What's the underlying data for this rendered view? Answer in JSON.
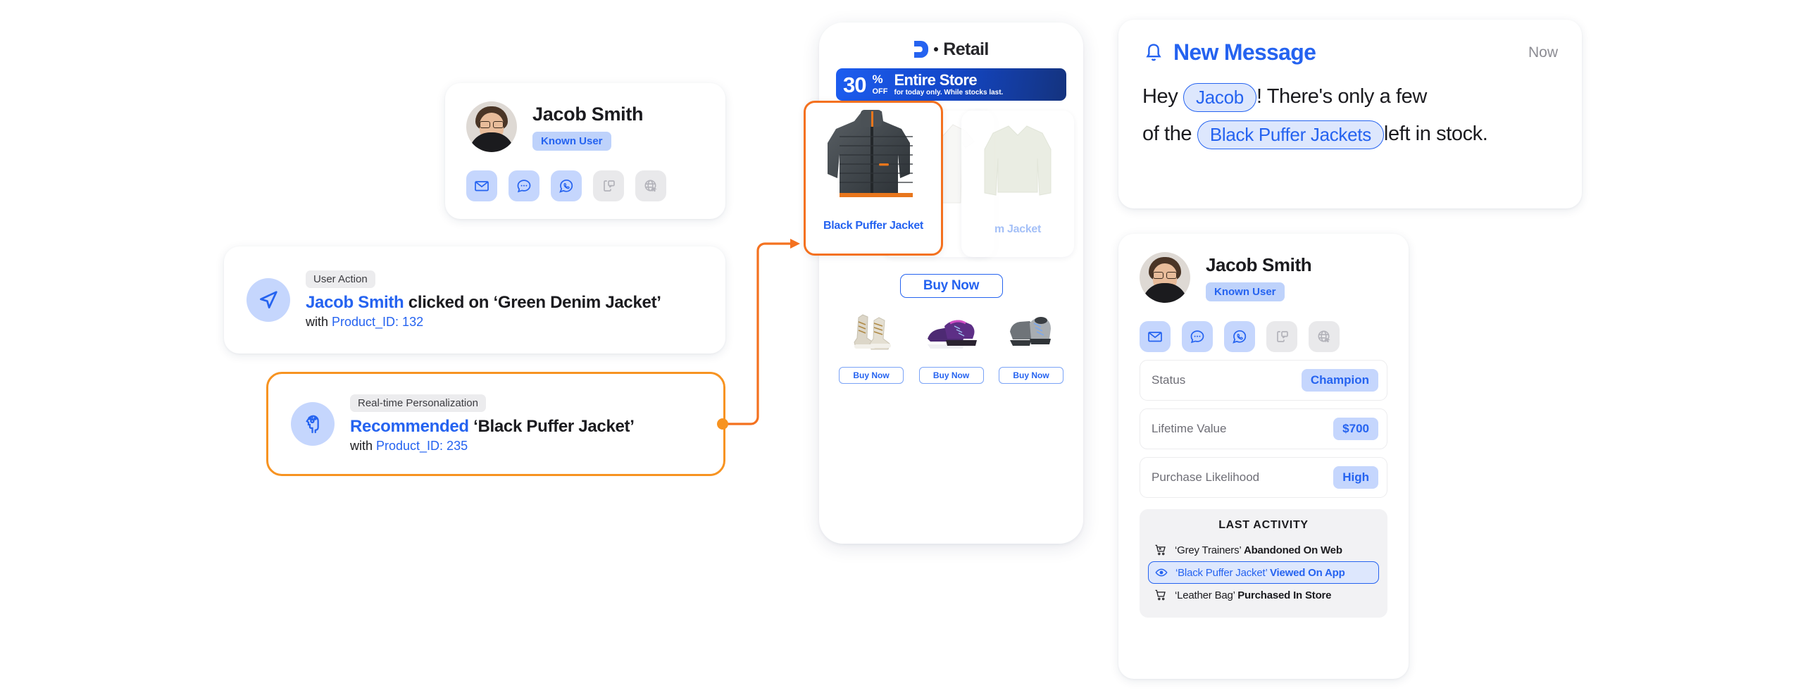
{
  "profile_left": {
    "name": "Jacob Smith",
    "badge": "Known User",
    "channels": [
      {
        "icon": "email-icon",
        "state": "active"
      },
      {
        "icon": "chat-bubble-icon",
        "state": "active"
      },
      {
        "icon": "whatsapp-icon",
        "state": "active"
      },
      {
        "icon": "sms-icon",
        "state": "inactive"
      },
      {
        "icon": "web-push-icon",
        "state": "inactive"
      }
    ]
  },
  "events": [
    {
      "tag": "User Action",
      "icon": "navigation-arrow-icon",
      "line1_highlight": "Jacob Smith",
      "line1_rest": " clicked on ‘Green Denim Jacket’",
      "line2_prefix": "with ",
      "line2_highlight": "Product_ID: 132",
      "accent": "#2563f0"
    },
    {
      "tag": "Real-time Personalization",
      "icon": "ai-brain-icon",
      "line1_highlight": "Recommended",
      "line1_rest": " ‘Black Puffer Jacket’",
      "line2_prefix": "with ",
      "line2_highlight": "Product_ID: 235",
      "accent": "#f4711f"
    }
  ],
  "phone": {
    "brand": "Retail",
    "brand_mark": "dotdigital-d-icon",
    "promo": {
      "percent": "30",
      "percent_symbol": "%",
      "off": "OFF",
      "headline": "Entire Store",
      "subline": "for today only. While stocks last."
    },
    "products": [
      {
        "name": "Black Puffer Jacket",
        "focused": true
      },
      {
        "name": "White Shirt",
        "focused": false
      },
      {
        "name": "Green Denim Jacket",
        "focused": false,
        "visible_text": "m Jacket"
      }
    ],
    "buy_now": "Buy Now",
    "shoes": [
      {
        "name": "beige-high-top-trainers",
        "buy_label": "Buy Now"
      },
      {
        "name": "purple-running-trainers",
        "buy_label": "Buy Now"
      },
      {
        "name": "grey-hiking-trainers",
        "buy_label": "Buy Now"
      }
    ]
  },
  "message": {
    "title": "New Message",
    "icon": "bell-icon",
    "time": "Now",
    "part1": "Hey",
    "chip1": "Jacob",
    "part2": "! There's only a few",
    "part3": "of the",
    "chip2": "Black Puffer Jackets",
    "part4": "left in stock."
  },
  "profile_right": {
    "name": "Jacob Smith",
    "badge": "Known User",
    "channels": [
      {
        "icon": "email-icon",
        "state": "active"
      },
      {
        "icon": "chat-bubble-icon",
        "state": "active"
      },
      {
        "icon": "whatsapp-icon",
        "state": "active"
      },
      {
        "icon": "sms-icon",
        "state": "inactive"
      },
      {
        "icon": "web-push-icon",
        "state": "inactive"
      }
    ],
    "attributes": [
      {
        "key": "Status",
        "value": "Champion"
      },
      {
        "key": "Lifetime Value",
        "value": "$700"
      },
      {
        "key": "Purchase Likelihood",
        "value": "High"
      }
    ],
    "activity_title": "LAST ACTIVITY",
    "activity": [
      {
        "icon": "cart-remove-icon",
        "product": "‘Grey Trainers’",
        "action": "Abandoned On Web",
        "highlighted": false
      },
      {
        "icon": "eye-icon",
        "product": "‘Black Puffer Jacket’",
        "action": "Viewed On App",
        "highlighted": true
      },
      {
        "icon": "cart-icon",
        "product": "‘Leather Bag’",
        "action": "Purchased In Store",
        "highlighted": false
      }
    ]
  },
  "colors": {
    "accent_blue": "#2563f0",
    "accent_orange": "#f4711f",
    "chip_bg": "#dde7fd",
    "badge_bg": "#c5d6fd",
    "page_bg": "#ffffff"
  }
}
